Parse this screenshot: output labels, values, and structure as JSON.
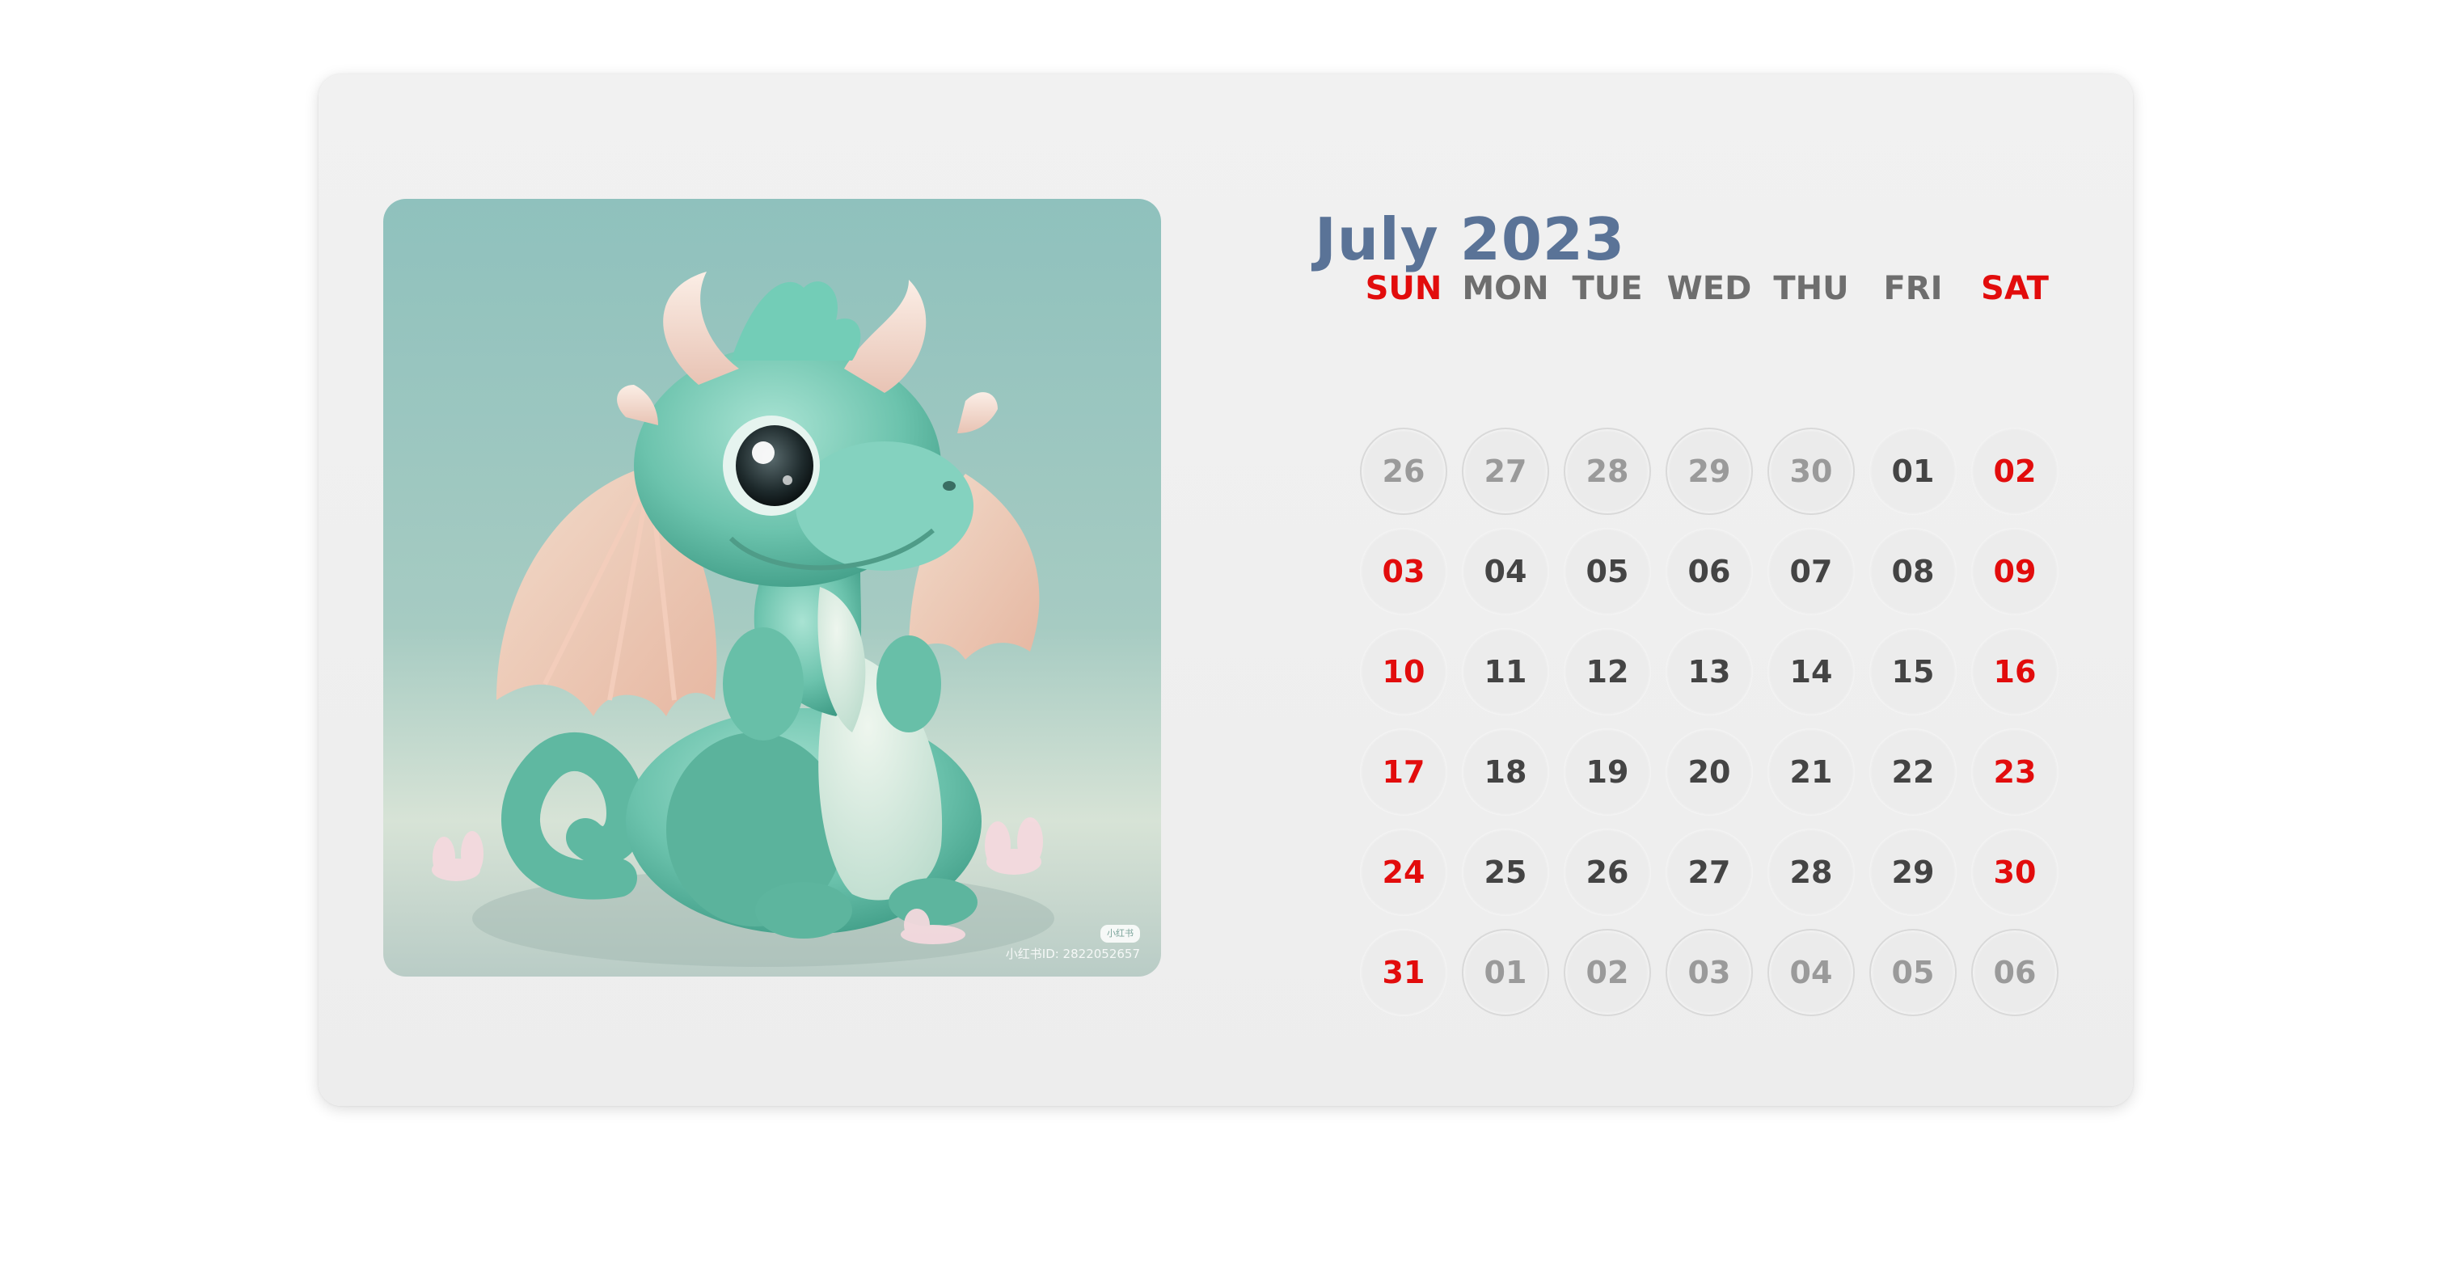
{
  "calendar": {
    "title": "July 2023",
    "weekdays": [
      {
        "label": "SUN",
        "weekend": true
      },
      {
        "label": "MON",
        "weekend": false
      },
      {
        "label": "TUE",
        "weekend": false
      },
      {
        "label": "WED",
        "weekend": false
      },
      {
        "label": "THU",
        "weekend": false
      },
      {
        "label": "FRI",
        "weekend": false
      },
      {
        "label": "SAT",
        "weekend": true
      }
    ],
    "weeks": [
      [
        {
          "label": "26",
          "current": false
        },
        {
          "label": "27",
          "current": false
        },
        {
          "label": "28",
          "current": false
        },
        {
          "label": "29",
          "current": false
        },
        {
          "label": "30",
          "current": false
        },
        {
          "label": "01",
          "current": true
        },
        {
          "label": "02",
          "current": true
        }
      ],
      [
        {
          "label": "03",
          "current": true
        },
        {
          "label": "04",
          "current": true
        },
        {
          "label": "05",
          "current": true
        },
        {
          "label": "06",
          "current": true
        },
        {
          "label": "07",
          "current": true
        },
        {
          "label": "08",
          "current": true
        },
        {
          "label": "09",
          "current": true
        }
      ],
      [
        {
          "label": "10",
          "current": true
        },
        {
          "label": "11",
          "current": true
        },
        {
          "label": "12",
          "current": true
        },
        {
          "label": "13",
          "current": true
        },
        {
          "label": "14",
          "current": true
        },
        {
          "label": "15",
          "current": true
        },
        {
          "label": "16",
          "current": true
        }
      ],
      [
        {
          "label": "17",
          "current": true
        },
        {
          "label": "18",
          "current": true
        },
        {
          "label": "19",
          "current": true
        },
        {
          "label": "20",
          "current": true
        },
        {
          "label": "21",
          "current": true
        },
        {
          "label": "22",
          "current": true
        },
        {
          "label": "23",
          "current": true
        }
      ],
      [
        {
          "label": "24",
          "current": true
        },
        {
          "label": "25",
          "current": true
        },
        {
          "label": "26",
          "current": true
        },
        {
          "label": "27",
          "current": true
        },
        {
          "label": "28",
          "current": true
        },
        {
          "label": "29",
          "current": true
        },
        {
          "label": "30",
          "current": true
        }
      ],
      [
        {
          "label": "31",
          "current": true
        },
        {
          "label": "01",
          "current": false
        },
        {
          "label": "02",
          "current": false
        },
        {
          "label": "03",
          "current": false
        },
        {
          "label": "04",
          "current": false
        },
        {
          "label": "05",
          "current": false
        },
        {
          "label": "06",
          "current": false
        }
      ]
    ]
  },
  "photo": {
    "watermark_logo": "小红书",
    "watermark_id": "小红书ID: 2822052657"
  },
  "colors": {
    "title": "#5a7397",
    "weekend": "#e20c0c",
    "weekday_header": "#6e6e6e",
    "day_text": "#444444",
    "other_month_text": "#9a9a9a"
  }
}
